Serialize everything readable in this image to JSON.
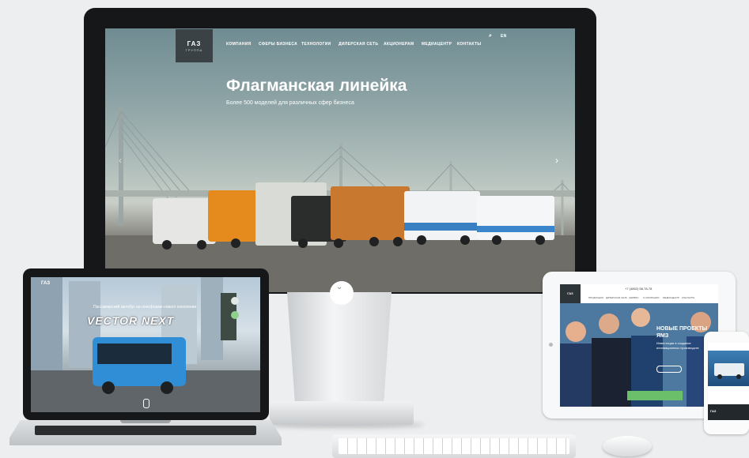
{
  "monitor": {
    "logo": "ГАЗ",
    "logo_sub": "ГРУППА",
    "nav": [
      "КОМПАНИЯ",
      "СФЕРЫ БИЗНЕСА",
      "ТЕХНОЛОГИИ",
      "ДИЛЕРСКАЯ СЕТЬ",
      "АКЦИОНЕРАМ",
      "МЕДИАЦЕНТР",
      "КОНТАКТЫ"
    ],
    "search_icon": "⌕",
    "lang": "EN",
    "hero_title": "Флагманская линейка",
    "hero_subtitle": "Более 500 моделей для различных сфер бизнеса",
    "scroll_icon": "⌄",
    "prev_arrow": "‹",
    "next_arrow": "›"
  },
  "laptop": {
    "logo": "ГАЗ",
    "subtitle": "Пассажирский автобус на платформе нового поколения",
    "title": "VECTOR NEXT"
  },
  "tablet": {
    "logo": "ГАЗ",
    "phone": "+7 (4852) 58-78-78",
    "nav": [
      "ПРОДУКЦИЯ",
      "ДИЛЕРСКАЯ СЕТЬ",
      "СЕРВИС",
      "О КОМПАНИИ",
      "МЕДИАЦЕНТР",
      "КОНТАКТЫ"
    ],
    "news_title": "НОВЫЕ ПРОЕКТЫ ЯМЗ",
    "news_subtitle": "Инвестиции в создание инновационных производств"
  },
  "phone": {
    "logo": "ГАЗ"
  },
  "colors": {
    "bezel": "#161718",
    "logo_box": "#3a4246",
    "page_bg": "#eceeef"
  }
}
